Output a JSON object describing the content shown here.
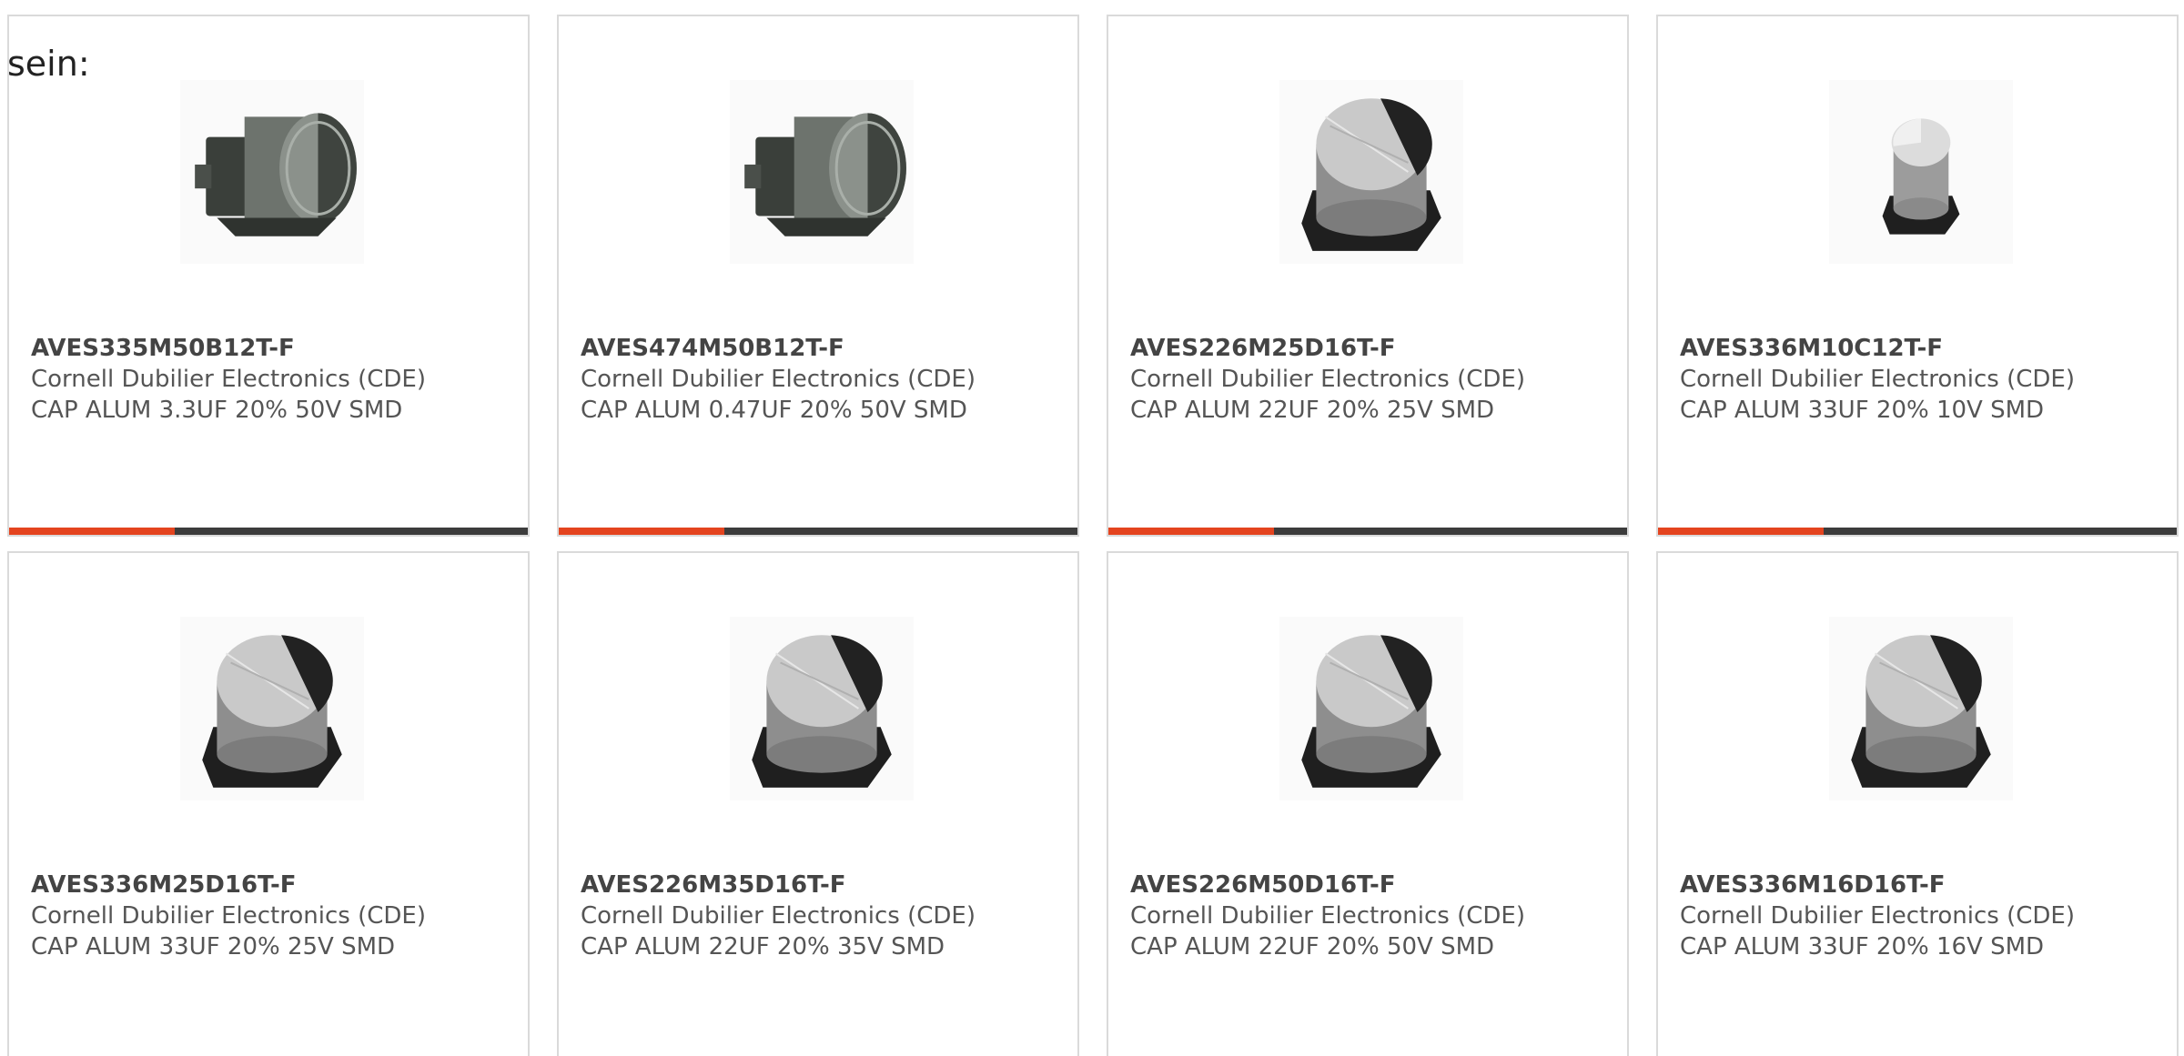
{
  "intro_text": "sein:",
  "accent_color": "#e4441f",
  "bar_color": "#3c3c3c",
  "products": [
    {
      "part_number": "AVES335M50B12T-F",
      "manufacturer": "Cornell Dubilier Electronics (CDE)",
      "description": "CAP ALUM 3.3UF 20% 50V SMD",
      "image": "capacitor-side-image",
      "show_bar": true
    },
    {
      "part_number": "AVES474M50B12T-F",
      "manufacturer": "Cornell Dubilier Electronics (CDE)",
      "description": "CAP ALUM 0.47UF 20% 50V SMD",
      "image": "capacitor-side-image",
      "show_bar": true
    },
    {
      "part_number": "AVES226M25D16T-F",
      "manufacturer": "Cornell Dubilier Electronics (CDE)",
      "description": "CAP ALUM 22UF 20% 25V SMD",
      "image": "capacitor-top-image",
      "show_bar": true
    },
    {
      "part_number": "AVES336M10C12T-F",
      "manufacturer": "Cornell Dubilier Electronics (CDE)",
      "description": "CAP ALUM 33UF 20% 10V SMD",
      "image": "capacitor-small-image",
      "show_bar": true
    },
    {
      "part_number": "AVES336M25D16T-F",
      "manufacturer": "Cornell Dubilier Electronics (CDE)",
      "description": "CAP ALUM 33UF 20% 25V SMD",
      "image": "capacitor-top-image",
      "show_bar": false
    },
    {
      "part_number": "AVES226M35D16T-F",
      "manufacturer": "Cornell Dubilier Electronics (CDE)",
      "description": "CAP ALUM 22UF 20% 35V SMD",
      "image": "capacitor-top-image",
      "show_bar": false
    },
    {
      "part_number": "AVES226M50D16T-F",
      "manufacturer": "Cornell Dubilier Electronics (CDE)",
      "description": "CAP ALUM 22UF 20% 50V SMD",
      "image": "capacitor-top-image",
      "show_bar": false
    },
    {
      "part_number": "AVES336M16D16T-F",
      "manufacturer": "Cornell Dubilier Electronics (CDE)",
      "description": "CAP ALUM 33UF 20% 16V SMD",
      "image": "capacitor-top-image",
      "show_bar": false
    }
  ]
}
